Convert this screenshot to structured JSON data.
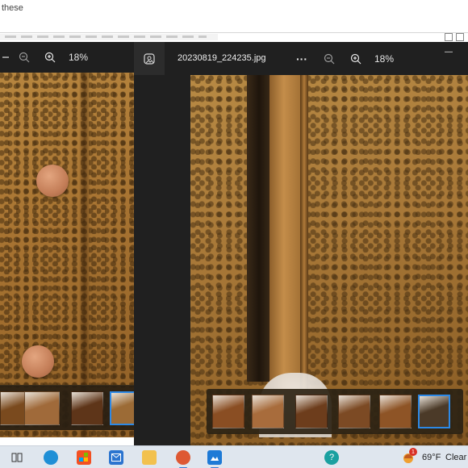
{
  "browser": {
    "partial_text": "these"
  },
  "viewer_left": {
    "zoom_label": "18%",
    "thumbnails": [
      {
        "color": "#7a4a1e"
      },
      {
        "color": "#a06a3a"
      },
      {
        "color": "#5e3519"
      },
      {
        "color": "#9c6b36"
      }
    ]
  },
  "viewer_right": {
    "filename": "20230819_224235.jpg",
    "more_label": "···",
    "zoom_label": "18%",
    "minimize_label": "—",
    "thumbnails": [
      {
        "color": "#8a4e23"
      },
      {
        "color": "#a86c3c"
      },
      {
        "color": "#6d3d1c"
      },
      {
        "color": "#7c4a24"
      },
      {
        "color": "#8e5426"
      },
      {
        "color": "#4b3a28"
      }
    ]
  },
  "taskbar": {
    "weather_temp": "69°F",
    "weather_condition": "Clear",
    "notification_badge": "1",
    "apps": [
      {
        "name": "task-view",
        "color": "#3a3a3a"
      },
      {
        "name": "edge",
        "color": "#1f8fd6"
      },
      {
        "name": "store",
        "color": "#f25022"
      },
      {
        "name": "mail",
        "color": "#2b74cf"
      },
      {
        "name": "file-explorer",
        "color": "#f2c14e"
      },
      {
        "name": "duckduckgo",
        "color": "#de5833"
      },
      {
        "name": "photos",
        "color": "#1e7ad6"
      },
      {
        "name": "help",
        "color": "#1aa0a0"
      }
    ]
  }
}
